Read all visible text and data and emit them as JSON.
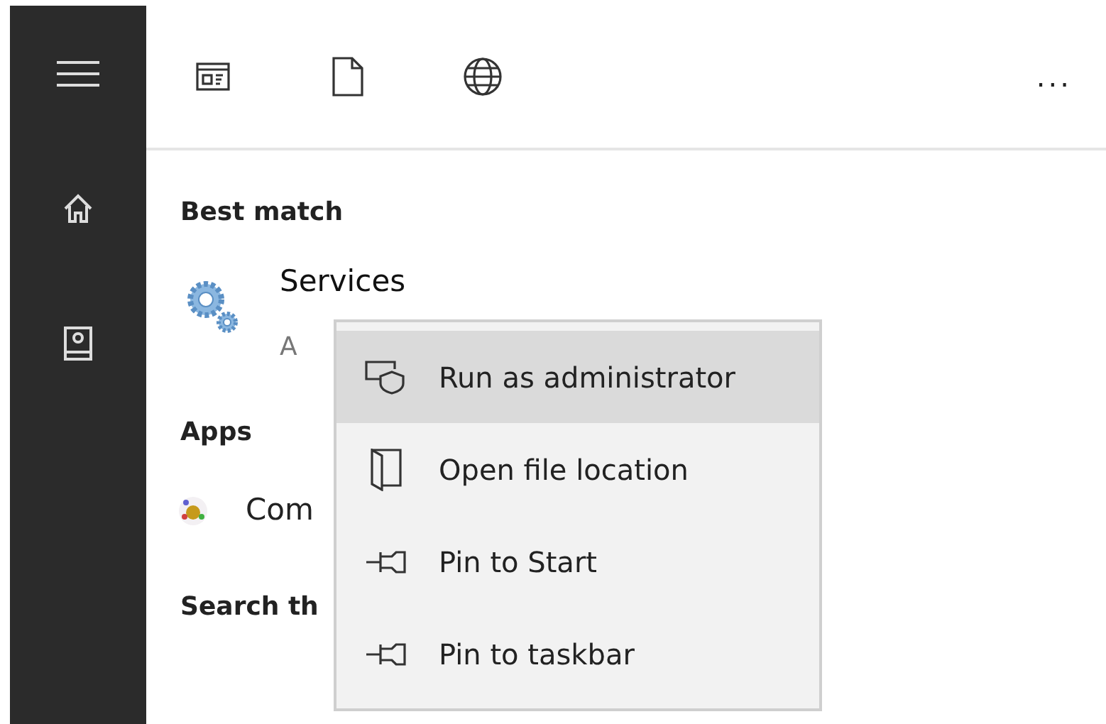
{
  "sidebar": {
    "items": [
      {
        "kind": "menu",
        "selected": false
      },
      {
        "kind": "home",
        "selected": false
      },
      {
        "kind": "account",
        "selected": false
      }
    ]
  },
  "toolbar": {
    "filters": [
      {
        "kind": "apps"
      },
      {
        "kind": "documents"
      },
      {
        "kind": "web"
      }
    ],
    "more": "..."
  },
  "sections": [
    {
      "title": "Best match",
      "items": [
        {
          "kind": "gears",
          "name": "Services",
          "subtitle": "A"
        }
      ]
    },
    {
      "title": "Apps",
      "items": [
        {
          "kind": "app",
          "name": "Com"
        }
      ]
    },
    {
      "title": "Search th"
    }
  ],
  "context_menu": {
    "items": [
      {
        "kind": "shield",
        "label": "Run as administrator",
        "selected": true
      },
      {
        "kind": "folder",
        "label": "Open file location",
        "selected": false
      },
      {
        "kind": "pin",
        "label": "Pin to Start",
        "selected": false
      },
      {
        "kind": "pin",
        "label": "Pin to taskbar",
        "selected": false
      }
    ]
  }
}
